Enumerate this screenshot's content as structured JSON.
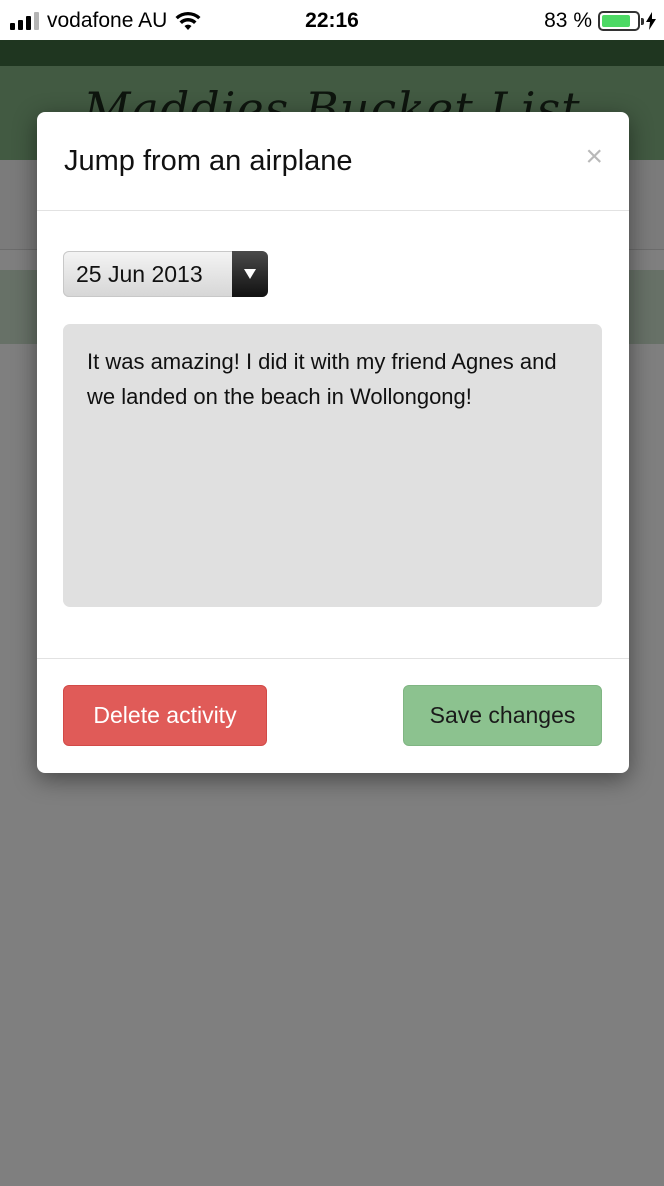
{
  "status_bar": {
    "carrier": "vodafone AU",
    "time": "22:16",
    "battery_percent": "83 %",
    "battery_level": 0.83,
    "battery_color": "#4cd964"
  },
  "background_page": {
    "title": "Maddies Bucket List"
  },
  "modal": {
    "title": "Jump from an airplane",
    "close_label": "×",
    "date_value": "25 Jun 2013",
    "notes": "It was amazing! I did it with my friend Agnes and we landed on the beach in Wollongong!",
    "delete_label": "Delete activity",
    "save_label": "Save changes",
    "delete_color": "#e05b58",
    "save_color": "#8cc28f"
  },
  "icons": [
    "signal-icon",
    "wifi-icon",
    "battery-icon",
    "charging-icon",
    "close-icon",
    "dropdown-arrow-icon"
  ]
}
